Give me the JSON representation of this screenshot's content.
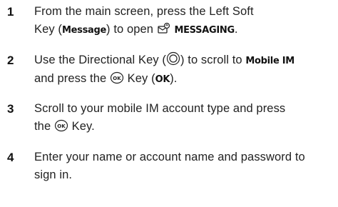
{
  "steps": [
    {
      "number": "1",
      "line1": "From the main screen, press the Left Soft",
      "line2_a": "Key (",
      "soft_key_label": "Message",
      "line2_b": ") to open ",
      "menu_name": "MESSAGING",
      "line2_c": ".",
      "icon": "messaging-icon"
    },
    {
      "number": "2",
      "line1_a": "Use the Directional Key (",
      "line1_b": ") to scroll to ",
      "menu_item": "Mobile IM",
      "line2_a": "and press the ",
      "line2_b": " Key (",
      "ok_label": "OK",
      "line2_c": ").",
      "icons": [
        "directional-key-icon",
        "ok-key-icon"
      ]
    },
    {
      "number": "3",
      "line1": "Scroll to your mobile IM account type and press",
      "line2_a": "the ",
      "line2_b": " Key.",
      "icon": "ok-key-icon"
    },
    {
      "number": "4",
      "line1": "Enter your name or account name and password to",
      "line2": "sign in."
    }
  ]
}
